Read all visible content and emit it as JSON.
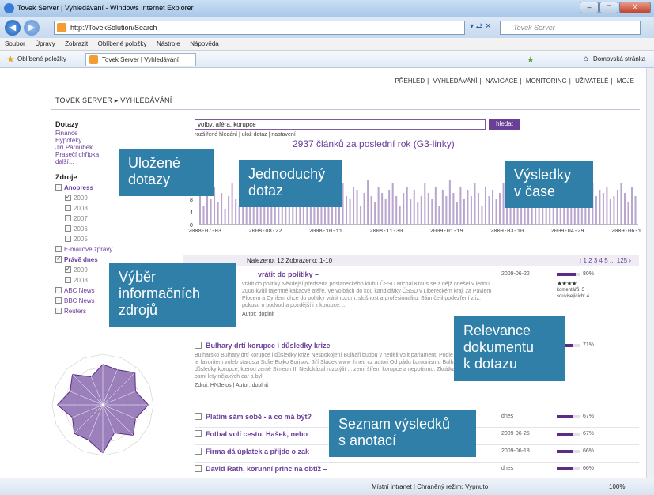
{
  "window": {
    "title": "Tovek Server | Vyhledávání - Windows Internet Explorer",
    "buttons": [
      "–",
      "□",
      "X"
    ]
  },
  "address": {
    "url": "http://TovekSolution/Search",
    "search_placeholder": "Tovek Server"
  },
  "menu": [
    "Soubor",
    "Úpravy",
    "Zobrazit",
    "Oblíbené položky",
    "Nástroje",
    "Nápověda"
  ],
  "favbar": {
    "label": "Oblíbené položky",
    "tab": "Tovek Server | Vyhledávání",
    "home": "Domovská stránka"
  },
  "topnav": [
    "PŘEHLED",
    "VYHLEDÁVÁNÍ",
    "NAVIGACE",
    "MONITORING",
    "UŽIVATELÉ",
    "MOJE"
  ],
  "brand": "TOVEK SERVER ▸ VYHLEDÁVÁNÍ",
  "sidebar": {
    "queries_title": "Dotazy",
    "queries": [
      "Finance",
      "Hypotéky",
      "Jiří Paroubek",
      "Prasečí chřipka",
      "další..."
    ],
    "sources_title": "Zdroje",
    "sources": [
      {
        "label": "Anopress",
        "checked": false,
        "sub": false,
        "bold": true
      },
      {
        "label": "2009",
        "checked": true,
        "sub": true
      },
      {
        "label": "2008",
        "checked": false,
        "sub": true
      },
      {
        "label": "2007",
        "checked": false,
        "sub": true
      },
      {
        "label": "2006",
        "checked": false,
        "sub": true
      },
      {
        "label": "2005",
        "checked": false,
        "sub": true
      },
      {
        "label": "E-mailové zprávy",
        "checked": false,
        "sub": false
      },
      {
        "label": "Právě dnes",
        "checked": true,
        "sub": false,
        "bold": true
      },
      {
        "label": "2009",
        "checked": true,
        "sub": true
      },
      {
        "label": "2008",
        "checked": false,
        "sub": true
      },
      {
        "label": "ABC News",
        "checked": false,
        "sub": false
      },
      {
        "label": "BBC News",
        "checked": false,
        "sub": false
      },
      {
        "label": "Reuters",
        "checked": false,
        "sub": false
      }
    ]
  },
  "query": {
    "value": "volby, aféra, korupce",
    "button": "hledat",
    "links": "rozšířené hledání | ulož dotaz | nastavení"
  },
  "chart_title": "2937 článků za poslední rok (G3-linky)",
  "chart_data": {
    "type": "bar",
    "x_ticks": [
      "2008-07-03",
      "2008-08-22",
      "2008-10-11",
      "2008-11-30",
      "2009-01-19",
      "2009-03-10",
      "2009-04-29",
      "2009-06-1"
    ],
    "y_ticks": [
      "0",
      "4",
      "8"
    ],
    "ylim": [
      0,
      20
    ],
    "values": [
      9,
      6,
      11,
      8,
      12,
      7,
      10,
      5,
      9,
      13,
      8,
      6,
      11,
      9,
      7,
      12,
      10,
      8,
      14,
      6,
      9,
      11,
      7,
      10,
      12,
      8,
      6,
      13,
      9,
      11,
      7,
      10,
      15,
      8,
      12,
      9,
      6,
      11,
      10,
      7,
      13,
      9,
      8,
      12,
      11,
      6,
      10,
      14,
      9,
      7,
      12,
      10,
      8,
      11,
      13,
      9,
      6,
      10,
      12,
      8,
      11,
      7,
      9,
      13,
      10,
      8,
      12,
      6,
      11,
      9,
      14,
      10,
      7,
      12,
      8,
      11,
      9,
      13,
      10,
      6,
      12,
      9,
      11,
      8,
      10,
      13,
      7,
      9,
      12,
      10,
      8,
      11,
      16,
      9,
      12,
      10,
      7,
      13,
      11,
      9,
      8,
      12,
      10,
      14,
      9,
      11,
      7,
      12,
      10,
      8,
      13,
      9,
      11,
      10,
      12,
      8,
      9,
      11,
      13,
      10,
      7,
      12,
      9
    ]
  },
  "pager": {
    "info": "Nalezeno: 12  Zobrazeno: 1-10",
    "pages": "‹ 1 2 3 4 5 ... 125 ›"
  },
  "results": [
    {
      "title": "vrátit do politiky –",
      "text": "vrátit do politiky Někdejší předseda poslaneckého klubu ČSSD Michal Kraus se z nějž odešel v lednu 2006 kvůli tajemné kakaové aféře. Ve volbách do kou kandidátky ČSSD v Libereckém kraji za Pavlem Plocem a Cyrilem chce do politiky vrátit rozum, slušnost a profesionalitu. Sám čelil podezření z iz, pokusu o podvod a pozdější i z korupce. ...",
      "source": "Autor: doplnit",
      "date": "2009-06-22",
      "relevance": 80,
      "stars": "★★★★",
      "comments": "komentářů: 5",
      "related": "souvisejících: 4"
    },
    {
      "title": "Bulhary drtí korupce i důsledky krize –",
      "text": "Bulharsko Bulhary drtí korupce i důsledky krize Nespokojení Bulhaři budou v neděli volit parlament. Podle průzkumů je favoritem voleb starosta Sofie Bojko Borisov. Jiří Sládek www ihned cz autori Od pádu komunismu Bulhaři vnímají důsledky korupce, kterou země Simeon II. Nedokázal rozptýlit ... zemi šíření korupce a nepotismu. Zkrátka je před osmi lety nějakých car a byl",
      "source": "Zdroj: HNJetos | Autor: doplnit",
      "date": "",
      "relevance": 71
    }
  ],
  "compact_results": [
    {
      "title": "Platím sám sobě - a co má být?",
      "date": "dnes",
      "relevance": 67
    },
    {
      "title": "Fotbal volí cestu. Hašek, nebo",
      "date": "2009-06-25",
      "relevance": 67
    },
    {
      "title": "Firma dá úplatek a přijde o zak",
      "date": "2009-06-18",
      "relevance": 66
    },
    {
      "title": "David Rath, korunní princ na obtíž –",
      "date": "dnes",
      "relevance": 66
    }
  ],
  "callouts": {
    "saved_queries": "Uložené\ndotazy",
    "simple_query": "Jednoduchý\ndotaz",
    "results_time": "Výsledky\nv čase",
    "sources": "Výběr\ninformačních\nzdrojů",
    "relevance": "Relevance\ndokumentu\nk dotazu",
    "result_list": "Seznam výsledků\ns anotací"
  },
  "status": {
    "zone": "Místní intranet | Chráněný režim: Vypnuto",
    "zoom": "100%"
  },
  "colors": {
    "accent": "#6a3d9a",
    "callout": "#2f7fa8",
    "bar": "#b9a6cf"
  }
}
